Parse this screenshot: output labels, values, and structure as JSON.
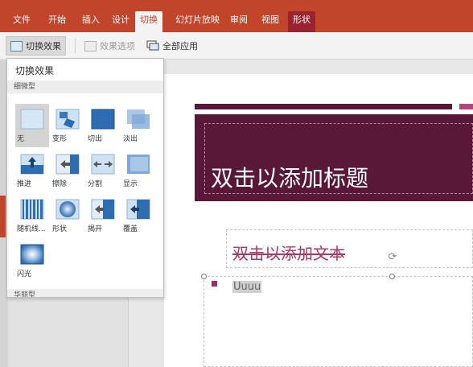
{
  "ribbon": {
    "tabs": [
      {
        "label": "文件"
      },
      {
        "label": "开始"
      },
      {
        "label": "插入"
      },
      {
        "label": "设计"
      },
      {
        "label": "切换"
      },
      {
        "label": "幻灯片放映"
      },
      {
        "label": "审阅"
      },
      {
        "label": "视图"
      },
      {
        "label": "形状"
      }
    ],
    "active_tab": "切换"
  },
  "toolbar": {
    "transition_effects_label": "切换效果",
    "effect_options_label": "效果选项",
    "apply_all_label": "全部应用"
  },
  "effects_panel": {
    "title": "切换效果",
    "subtle_section": "细微型",
    "exciting_section": "华丽型",
    "effects": [
      {
        "label": "无",
        "icon": "none-icon",
        "selected": true
      },
      {
        "label": "变形",
        "icon": "morph-icon"
      },
      {
        "label": "切出",
        "icon": "cut-icon"
      },
      {
        "label": "淡出",
        "icon": "fade-icon"
      },
      {
        "label": "推进",
        "icon": "push-icon"
      },
      {
        "label": "擦除",
        "icon": "wipe-icon"
      },
      {
        "label": "分割",
        "icon": "split-icon"
      },
      {
        "label": "显示",
        "icon": "reveal-icon"
      },
      {
        "label": "随机线...",
        "icon": "random-bars-icon"
      },
      {
        "label": "形状",
        "icon": "shape-icon"
      },
      {
        "label": "揭开",
        "icon": "uncover-icon"
      },
      {
        "label": "覆盖",
        "icon": "cover-icon"
      },
      {
        "label": "闪光",
        "icon": "flash-icon"
      }
    ]
  },
  "slide": {
    "title_placeholder": "双击以添加标题",
    "subtitle_placeholder": "双击以添加文本",
    "content_text": "Uuuu"
  },
  "colors": {
    "ribbon": "#c0452b",
    "title_block": "#5a1839",
    "accent_pink": "#b3457a"
  }
}
